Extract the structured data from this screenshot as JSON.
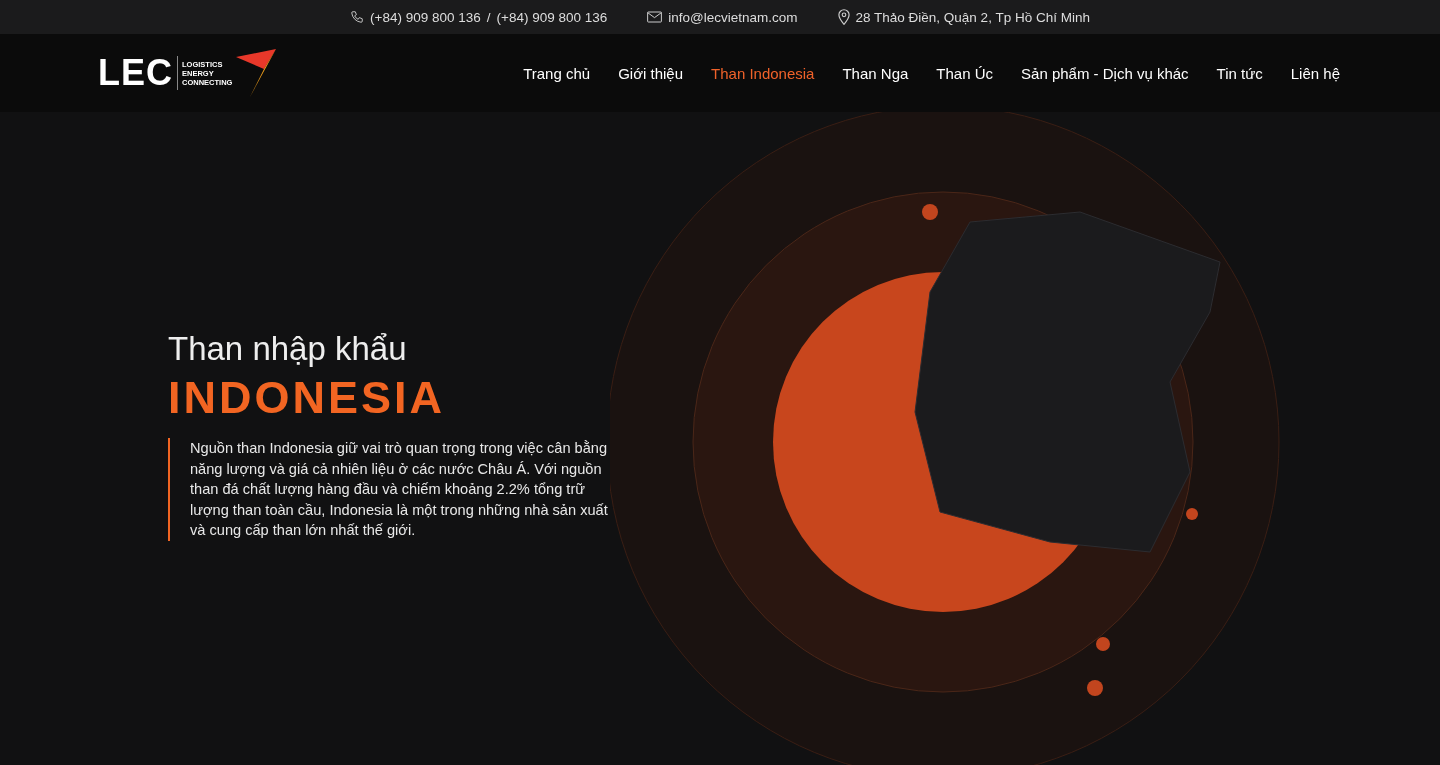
{
  "top_bar": {
    "phones": [
      "(+84) 909 800 136",
      "/",
      "(+84) 909 800 136"
    ],
    "email": "info@lecvietnam.com",
    "address": "28 Thảo Điền, Quận 2, Tp Hồ Chí Minh"
  },
  "logo": {
    "mark": "LEC",
    "tagline": [
      "LOGISTICS",
      "ENERGY",
      "CONNECTING"
    ]
  },
  "nav": [
    {
      "label": "Trang chủ",
      "selected": false
    },
    {
      "label": "Giới thiệu",
      "selected": false
    },
    {
      "label": "Than Indonesia",
      "selected": true
    },
    {
      "label": "Than Nga",
      "selected": false
    },
    {
      "label": "Than Úc",
      "selected": false
    },
    {
      "label": "Sản phẩm - Dịch vụ khác",
      "selected": false
    },
    {
      "label": "Tin tức",
      "selected": false
    },
    {
      "label": "Liên hệ",
      "selected": false
    }
  ],
  "hero": {
    "subtitle": "Than nhập khẩu",
    "title": "INDONESIA",
    "description": "Nguồn than Indonesia giữ vai trò quan trọng trong việc cân bằng năng lượng và giá cả nhiên liệu ở các nước Châu Á. Với nguồn than đá chất lượng hàng đầu và chiếm khoảng 2.2% tổng trữ lượng than toàn cầu, Indonesia là một trong những nhà sản xuất và cung cấp than lớn nhất thế giới."
  }
}
